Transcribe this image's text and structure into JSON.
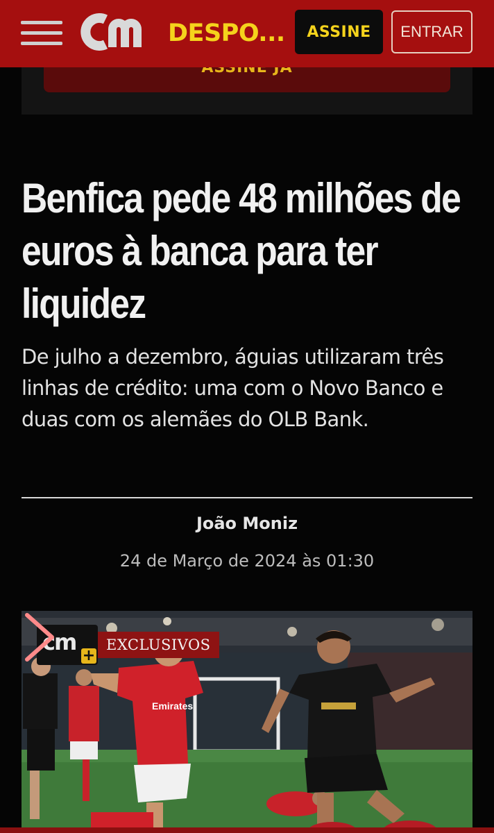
{
  "header": {
    "brand": "cm",
    "section": "DESPO...",
    "subscribe_label": "ASSINE",
    "login_label": "ENTRAR",
    "colors": {
      "bar": "#a50f0f",
      "accent": "#f5d31c"
    }
  },
  "promo": {
    "button_label": "ASSINE JÁ"
  },
  "article": {
    "headline": "Benfica pede 48 milhões de euros à banca para ter liquidez",
    "lead": "De julho a dezembro, águias utilizaram três linhas de crédito: uma com o Novo Banco e duas com os alemães do OLB Bank.",
    "author": "João Moniz",
    "date": "24 de Março de 2024 às 01:30"
  },
  "media": {
    "badge_brand": "cm",
    "badge_plus": "+",
    "badge_label": "EXCLUSIVOS",
    "shirt_sponsor": "Emirates",
    "next_icon": "chevron-right-icon"
  }
}
